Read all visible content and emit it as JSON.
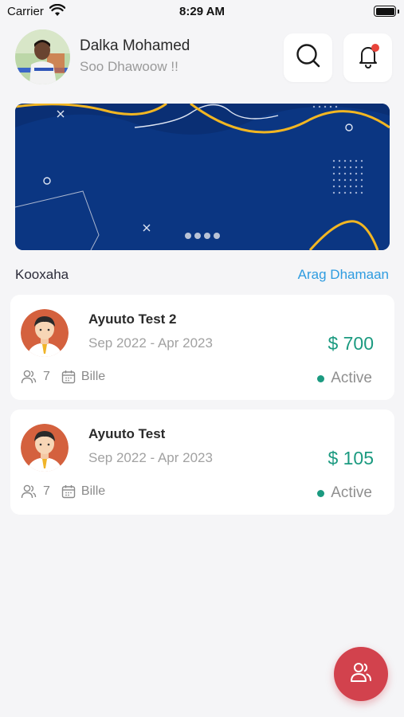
{
  "status_bar": {
    "carrier": "Carrier",
    "time": "8:29 AM"
  },
  "user": {
    "name": "Dalka Mohamed",
    "greeting": "Soo Dhawoow !!"
  },
  "header": {
    "search_icon": "search-icon",
    "bell_icon": "bell-icon"
  },
  "section": {
    "title": "Kooxaha",
    "see_all": "Arag Dhamaan"
  },
  "groups": [
    {
      "title": "Ayuuto Test 2",
      "dates": "Sep 2022 - Apr 2023",
      "amount": "$ 700",
      "members": "7",
      "frequency": "Bille",
      "status": "Active"
    },
    {
      "title": "Ayuuto Test",
      "dates": "Sep 2022 - Apr 2023",
      "amount": "$ 105",
      "members": "7",
      "frequency": "Bille",
      "status": "Active"
    }
  ],
  "colors": {
    "accent": "#1b9a80",
    "link": "#2f9ce0",
    "banner": "#0b3682",
    "fab": "#d2424d",
    "notification": "#e8443a"
  }
}
